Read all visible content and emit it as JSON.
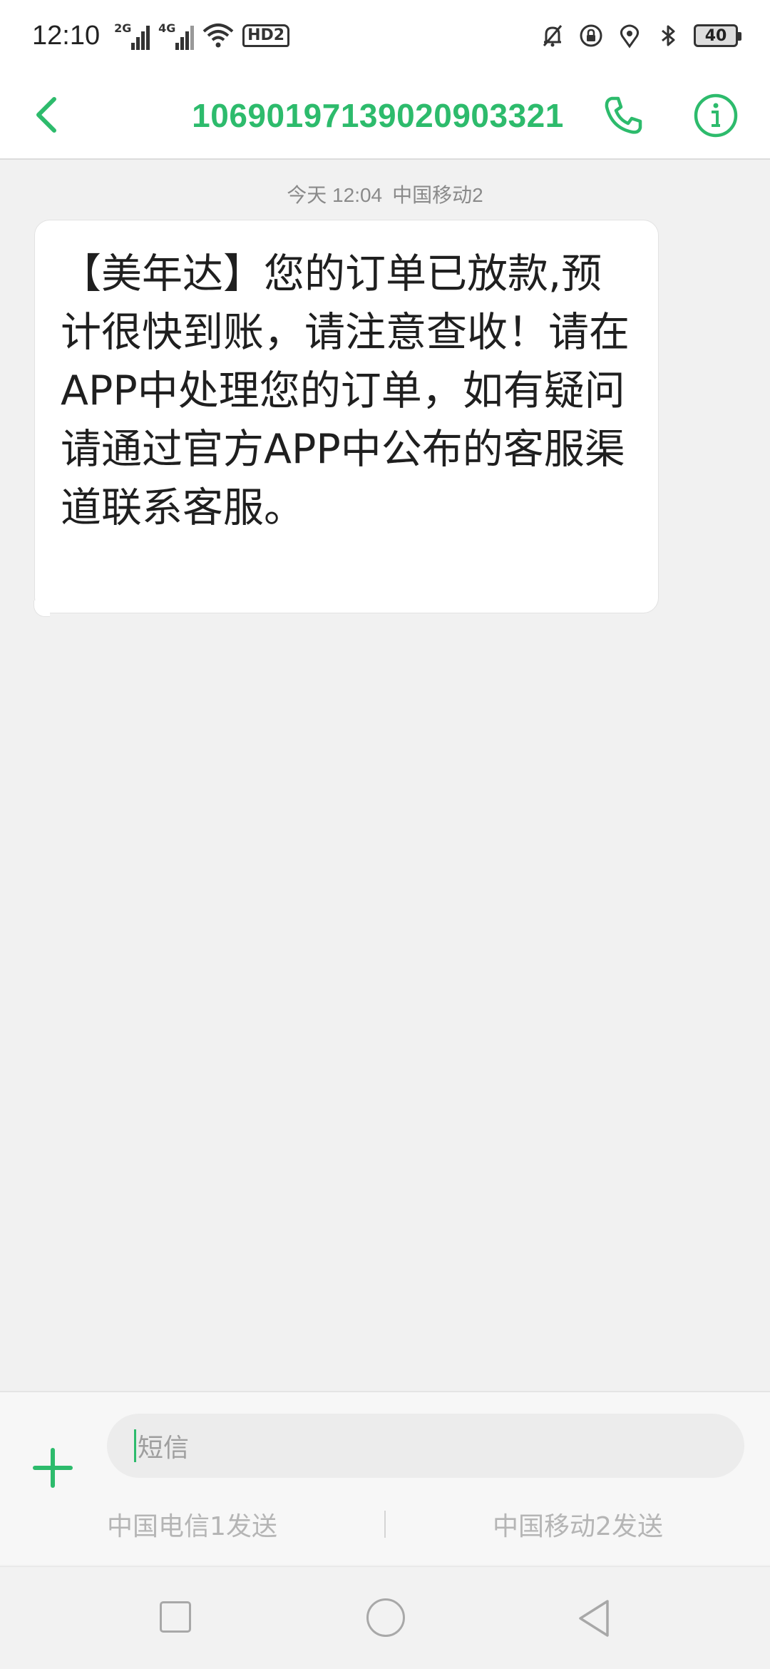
{
  "status_bar": {
    "time": "12:10",
    "signal1_tag": "2G",
    "signal2_tag": "4G",
    "hd_label": "HD2",
    "battery": "40",
    "icons": [
      "silent-bell-icon",
      "rotation-lock-icon",
      "location-icon",
      "bluetooth-icon"
    ]
  },
  "header": {
    "sender": "106901971390209033 21",
    "back_icon": "chevron-left-icon",
    "call_icon": "phone-icon",
    "info_icon": "info-icon",
    "accent_color": "#2dbb6c"
  },
  "conversation": {
    "messages": [
      {
        "date": "今天 12:04",
        "sim": "中国移动2",
        "text": "【美年达】您的订单已放款,预计很快到账，请注意查收！请在APP中处理您的订单，如有疑问请通过官方APP中公布的客服渠道联系客服。"
      }
    ]
  },
  "compose": {
    "add_icon": "plus-icon",
    "placeholder": "短信",
    "send_options": [
      "中国电信1发送",
      "中国移动2发送"
    ]
  },
  "navbar": {
    "icons": [
      "recent-apps-icon",
      "home-icon",
      "back-icon"
    ]
  }
}
